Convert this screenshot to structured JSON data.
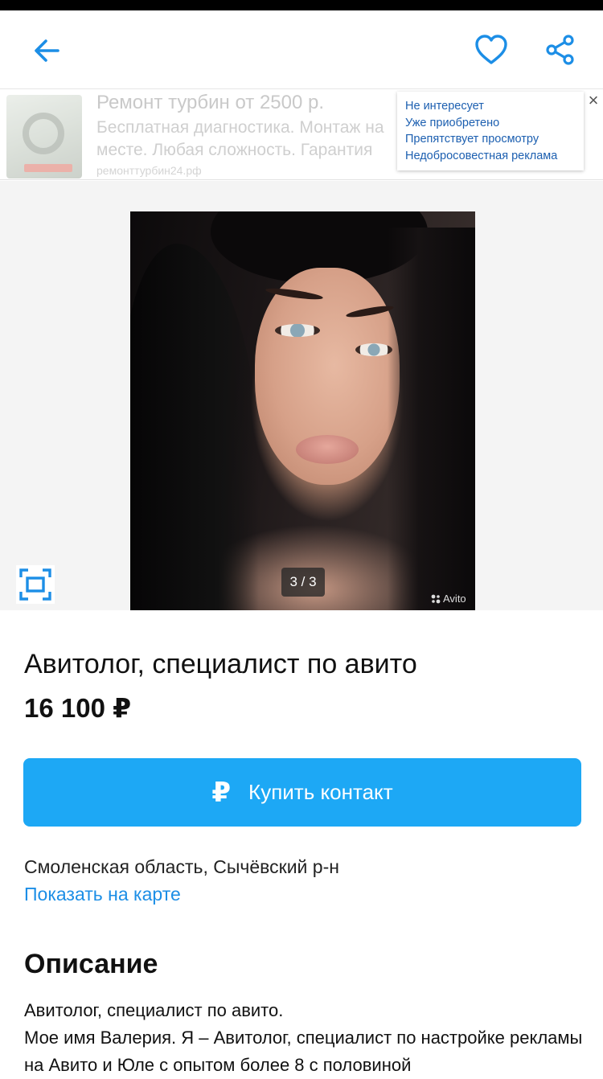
{
  "app_bar": {
    "back_icon": "arrow-left-icon",
    "favorite_icon": "heart-outline-icon",
    "share_icon": "share-icon",
    "accent_color": "#1c8ee6"
  },
  "ad": {
    "title": "Ремонт турбин от 2500 р.",
    "text": "Бесплатная диагностика. Монтаж на месте. Любая сложность. Гарантия",
    "domain": "ремонттурбин24.рф",
    "menu": [
      "Не интересует",
      "Уже приобретено",
      "Препятствует просмотру",
      "Недобросовестная реклама"
    ],
    "close_glyph": "×"
  },
  "gallery": {
    "counter": "3 / 3",
    "watermark": "Avito",
    "fullscreen_icon": "fullscreen-icon"
  },
  "listing": {
    "title": "Авитолог, специалист по авито",
    "price": "16 100 ₽",
    "buy_button": {
      "icon_glyph": "₽",
      "label": "Купить контакт",
      "color": "#1da8f5"
    },
    "location": "Смоленская область, Сычёвский р-н",
    "map_link": "Показать на карте"
  },
  "description": {
    "heading": "Описание",
    "line1": "Авитолог, специалист по авито.",
    "line2": "Мое имя Валерия. Я – Авитолог, специалист по настройке рекламы на Авито и Юле с опытом более 8 с половиной"
  }
}
